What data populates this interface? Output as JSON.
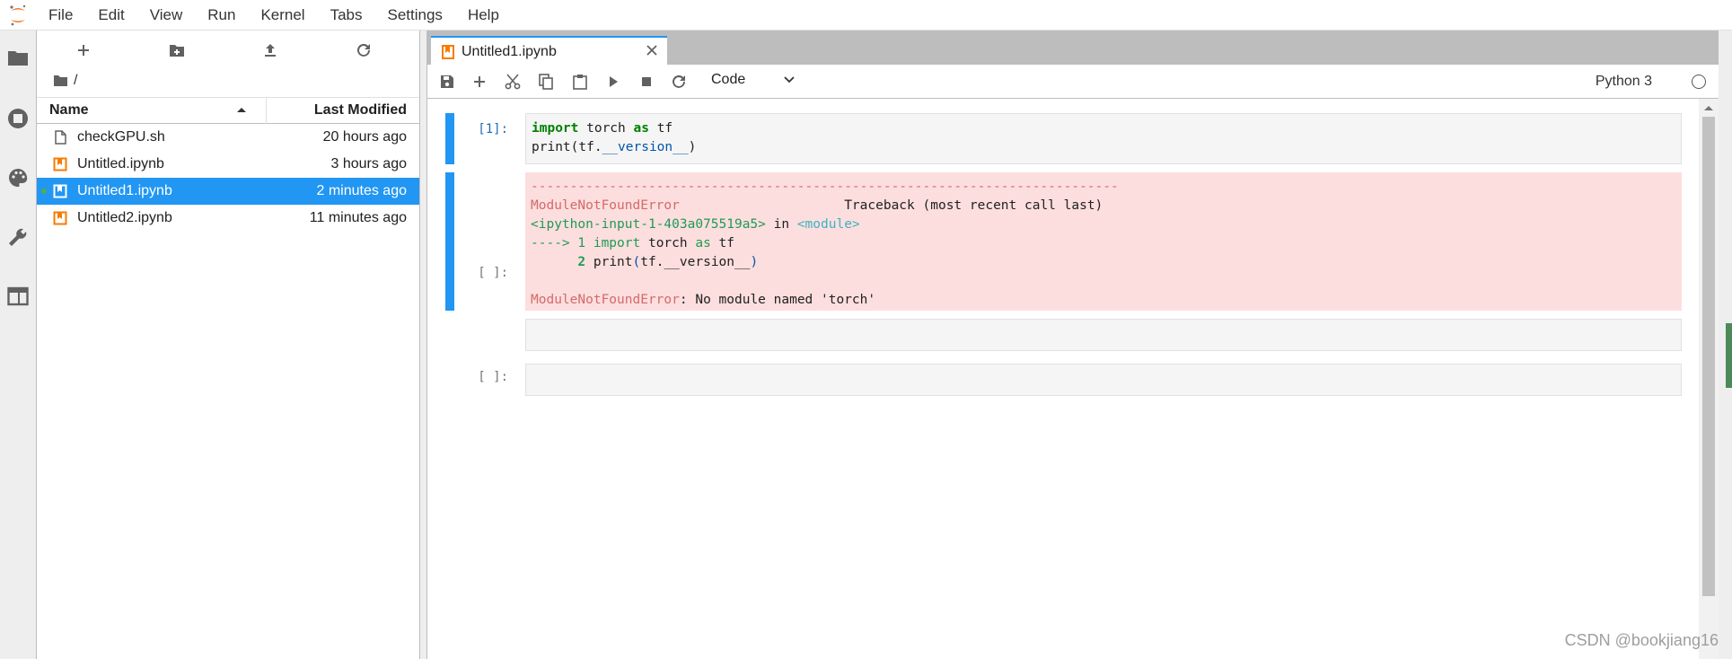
{
  "menubar": {
    "items": [
      "File",
      "Edit",
      "View",
      "Run",
      "Kernel",
      "Tabs",
      "Settings",
      "Help"
    ]
  },
  "sidebar": {
    "icons": [
      "folder-icon",
      "running-icon",
      "palette-icon",
      "wrench-icon",
      "tabs-icon"
    ]
  },
  "filebrowser": {
    "path": "/",
    "columns": {
      "name": "Name",
      "modified": "Last Modified"
    },
    "files": [
      {
        "name": "checkGPU.sh",
        "modified": "20 hours ago",
        "type": "file",
        "selected": false,
        "running": false
      },
      {
        "name": "Untitled.ipynb",
        "modified": "3 hours ago",
        "type": "notebook",
        "selected": false,
        "running": false
      },
      {
        "name": "Untitled1.ipynb",
        "modified": "2 minutes ago",
        "type": "notebook",
        "selected": true,
        "running": true
      },
      {
        "name": "Untitled2.ipynb",
        "modified": "11 minutes ago",
        "type": "notebook",
        "selected": false,
        "running": false
      }
    ]
  },
  "tab": {
    "label": "Untitled1.ipynb"
  },
  "toolbar": {
    "cell_type": "Code",
    "kernel_name": "Python 3"
  },
  "cells": {
    "c1": {
      "prompt": "[1]:",
      "output": {
        "rule": "---------------------------------------------------------------------------",
        "err_name": "ModuleNotFoundError",
        "traceback_label": "Traceback (most recent call last)",
        "input_ref": "<ipython-input-1-403a075519a5>",
        "in_word": " in ",
        "module_ref": "<module>",
        "arrow_line": "----> 1 ",
        "line1_kw": "import",
        "line1_rest": " torch ",
        "line1_as": "as",
        "line1_tail": " tf",
        "line2_num": "2",
        "line2_text": " print",
        "line2_paren": "(",
        "line2_mid": "tf.__version__",
        "line2_close": ")",
        "err_msg": ": No module named 'torch'"
      }
    },
    "c2": {
      "prompt": "[ ]:"
    },
    "c3": {
      "prompt": "[ ]:"
    }
  },
  "watermark": "CSDN @bookjiang16",
  "colors": {
    "accent": "#2196f3",
    "error_bg": "#fddede",
    "notebook_icon": "#f57c00"
  }
}
